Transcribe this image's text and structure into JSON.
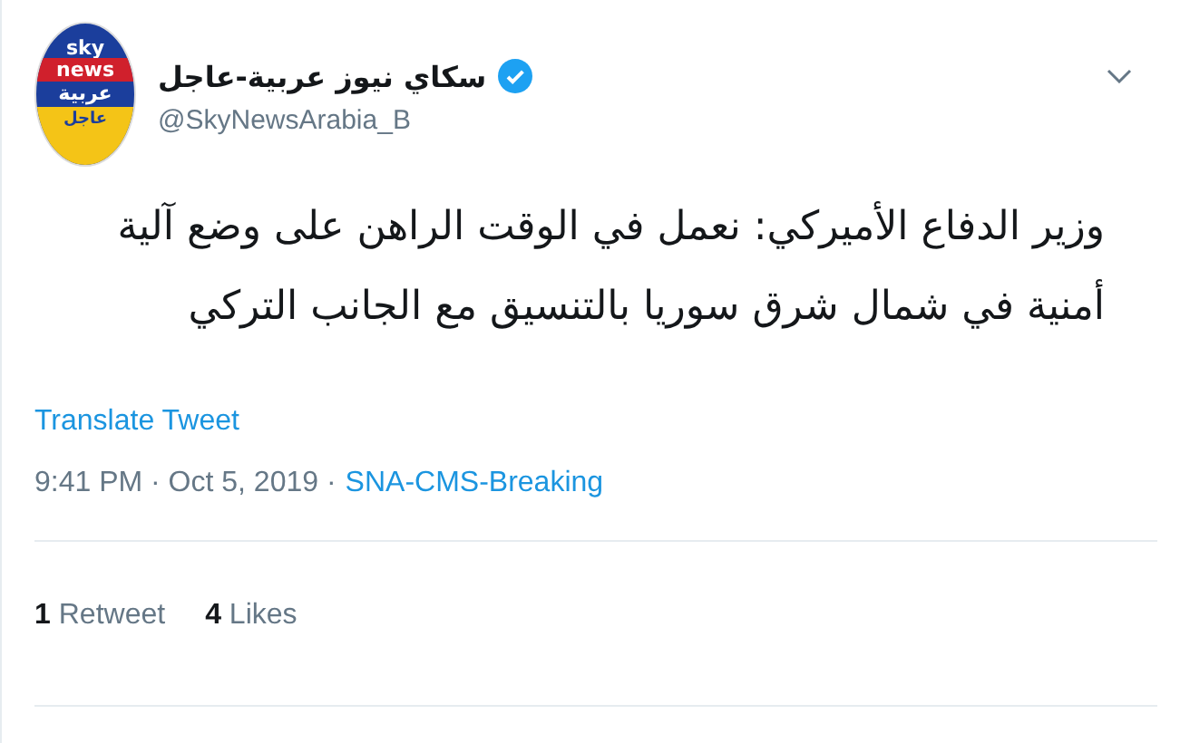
{
  "avatar": {
    "logo_lines": [
      "sky",
      "news",
      "عربية",
      "عاجل"
    ]
  },
  "author": {
    "name": "سكاي نيوز عربية-عاجل",
    "verified": true,
    "handle": "@SkyNewsArabia_B"
  },
  "tweet": {
    "text": "وزير الدفاع الأميركي: نعمل في الوقت الراهن على وضع آلية أمنية في شمال شرق سوريا بالتنسيق مع الجانب التركي"
  },
  "translate_link": "Translate Tweet",
  "meta": {
    "time": "9:41 PM · Oct 5, 2019 ·",
    "source": "SNA-CMS-Breaking"
  },
  "stats": {
    "retweets": {
      "count": "1",
      "label": "Retweet"
    },
    "likes": {
      "count": "4",
      "label": "Likes"
    }
  }
}
